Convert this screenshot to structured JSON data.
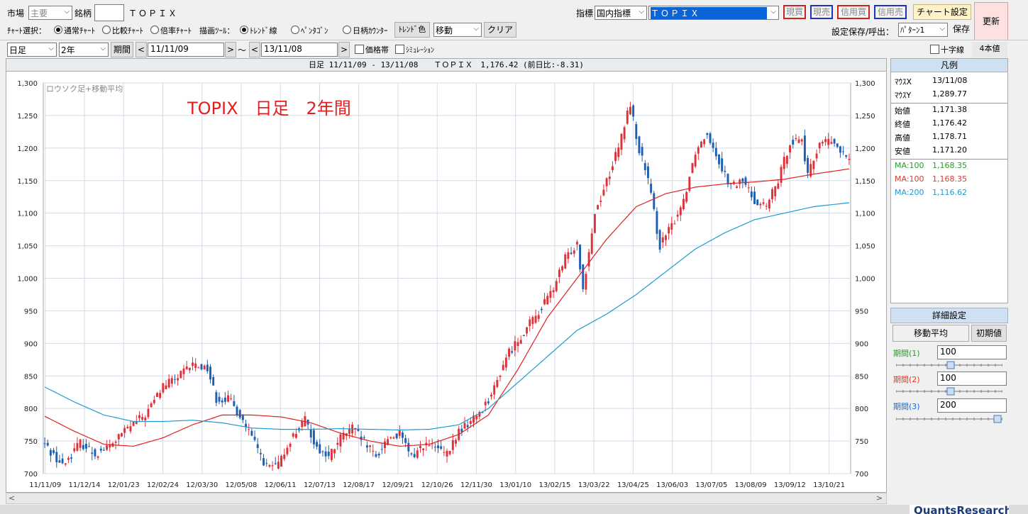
{
  "toolbar": {
    "market_label": "市場",
    "market_value": "主要",
    "symbol_label": "銘柄",
    "symbol_code": "",
    "symbol_name": "ＴＯＰＩＸ",
    "index_label": "指標",
    "index_category": "国内指標",
    "index_value": "ＴＯＰＩＸ",
    "buy_spot": "現買",
    "sell_spot": "現売",
    "buy_margin": "信用買",
    "sell_margin": "信用売",
    "chart_settings": "チャート設定",
    "refresh": "更新",
    "chart_type_label": "ﾁｬｰﾄ選択：",
    "chart_types": [
      "通常ﾁｬｰﾄ",
      "比較ﾁｬｰﾄ",
      "倍率ﾁｬｰﾄ"
    ],
    "draw_tool_label": "描画ﾂｰﾙ：",
    "draw_tools": [
      "ﾄﾚﾝﾄﾞ線",
      "ﾍﾟﾝﾀｺﾞﾝ",
      "日柄ｶｳﾝﾀｰ"
    ],
    "trend_color": "ﾄﾚﾝﾄﾞ色",
    "move_value": "移動",
    "clear": "クリア",
    "save_label": "設定保存/呼出：",
    "pattern_value": "ﾊﾟﾀｰﾝ1",
    "save": "保存",
    "interval_value": "日足",
    "span_value": "2年",
    "period_button": "期間",
    "date_from": "11/11/09",
    "tilde": "～",
    "date_to": "13/11/08",
    "price_band": "価格帯",
    "simulation": "ｼﾐｭﾚｰｼｮﾝ",
    "crosshair": "十字線",
    "four_price": "4本値"
  },
  "chart_header": "日足 11/11/09 - 13/11/08　　ＴＯＰＩＸ　1,176.42 (前日比:-8.31)",
  "chart_label": "ロウソク足+移動平均",
  "overlay_title": "TOPIX　日足　2年間",
  "legend": {
    "title": "凡例",
    "mouse_x_label": "ﾏｳｽX",
    "mouse_x": "13/11/08",
    "mouse_y_label": "ﾏｳｽY",
    "mouse_y": "1,289.77",
    "open_label": "始値",
    "open": "1,171.38",
    "close_label": "終値",
    "close": "1,176.42",
    "high_label": "高値",
    "high": "1,178.71",
    "low_label": "安値",
    "low": "1,171.20",
    "ma1_label": "MA:100",
    "ma1": "1,168.35",
    "ma2_label": "MA:100",
    "ma2": "1,168.35",
    "ma3_label": "MA:200",
    "ma3": "1,116.62"
  },
  "detail": {
    "title": "詳細設定",
    "tab": "移動平均",
    "init": "初期値",
    "p1_label": "期間(1)",
    "p1": "100",
    "p2_label": "期間(2)",
    "p2": "100",
    "p3_label": "期間(3)",
    "p3": "200"
  },
  "brand": "QuantsResearch",
  "colors": {
    "up": "#e0303a",
    "down": "#1f5fb0",
    "ma100": "#e02020",
    "ma200": "#1e9bd0",
    "ma_green": "#2a9a2a"
  },
  "chart_data": {
    "type": "candlestick",
    "y_ticks": [
      "1,300",
      "1,250",
      "1,200",
      "1,150",
      "1,100",
      "1,050",
      "1,000",
      "950",
      "900",
      "850",
      "800",
      "750",
      "700"
    ],
    "ylim": [
      700,
      1300
    ],
    "x_ticks": [
      "11/11/09",
      "11/12/14",
      "12/01/23",
      "12/02/24",
      "12/03/30",
      "12/05/08",
      "12/06/11",
      "12/07/13",
      "12/08/17",
      "12/09/21",
      "12/10/26",
      "12/11/30",
      "13/01/10",
      "13/02/15",
      "13/03/22",
      "13/04/25",
      "13/06/03",
      "13/07/05",
      "13/08/09",
      "13/09/12",
      "13/10/21"
    ],
    "price_path": [
      [
        0,
        745
      ],
      [
        6,
        712
      ],
      [
        12,
        748
      ],
      [
        17,
        730
      ],
      [
        22,
        742
      ],
      [
        28,
        770
      ],
      [
        34,
        790
      ],
      [
        40,
        835
      ],
      [
        45,
        848
      ],
      [
        50,
        868
      ],
      [
        55,
        862
      ],
      [
        58,
        815
      ],
      [
        62,
        815
      ],
      [
        66,
        790
      ],
      [
        70,
        755
      ],
      [
        75,
        710
      ],
      [
        79,
        712
      ],
      [
        83,
        752
      ],
      [
        88,
        782
      ],
      [
        92,
        740
      ],
      [
        96,
        725
      ],
      [
        100,
        755
      ],
      [
        104,
        770
      ],
      [
        108,
        748
      ],
      [
        112,
        725
      ],
      [
        116,
        755
      ],
      [
        120,
        760
      ],
      [
        124,
        725
      ],
      [
        128,
        745
      ],
      [
        132,
        740
      ],
      [
        136,
        728
      ],
      [
        140,
        765
      ],
      [
        144,
        780
      ],
      [
        148,
        800
      ],
      [
        152,
        830
      ],
      [
        156,
        880
      ],
      [
        160,
        905
      ],
      [
        164,
        930
      ],
      [
        168,
        955
      ],
      [
        172,
        985
      ],
      [
        176,
        1030
      ],
      [
        180,
        1055
      ],
      [
        182,
        985
      ],
      [
        186,
        1100
      ],
      [
        190,
        1150
      ],
      [
        194,
        1200
      ],
      [
        198,
        1270
      ],
      [
        200,
        1215
      ],
      [
        204,
        1150
      ],
      [
        208,
        1050
      ],
      [
        212,
        1080
      ],
      [
        216,
        1120
      ],
      [
        220,
        1195
      ],
      [
        224,
        1225
      ],
      [
        228,
        1180
      ],
      [
        232,
        1140
      ],
      [
        236,
        1150
      ],
      [
        240,
        1120
      ],
      [
        244,
        1110
      ],
      [
        248,
        1150
      ],
      [
        252,
        1210
      ],
      [
        256,
        1215
      ],
      [
        258,
        1155
      ],
      [
        262,
        1210
      ],
      [
        266,
        1210
      ],
      [
        270,
        1190
      ],
      [
        272,
        1178
      ]
    ],
    "ma100_path": [
      [
        0,
        788
      ],
      [
        10,
        765
      ],
      [
        20,
        745
      ],
      [
        30,
        742
      ],
      [
        40,
        755
      ],
      [
        50,
        775
      ],
      [
        60,
        790
      ],
      [
        70,
        790
      ],
      [
        80,
        787
      ],
      [
        90,
        778
      ],
      [
        100,
        762
      ],
      [
        110,
        750
      ],
      [
        120,
        742
      ],
      [
        130,
        745
      ],
      [
        140,
        760
      ],
      [
        150,
        790
      ],
      [
        160,
        860
      ],
      [
        170,
        940
      ],
      [
        180,
        1000
      ],
      [
        190,
        1060
      ],
      [
        200,
        1110
      ],
      [
        210,
        1130
      ],
      [
        220,
        1140
      ],
      [
        230,
        1145
      ],
      [
        240,
        1148
      ],
      [
        250,
        1152
      ],
      [
        260,
        1160
      ],
      [
        272,
        1168
      ]
    ],
    "ma200_path": [
      [
        0,
        833
      ],
      [
        10,
        810
      ],
      [
        20,
        790
      ],
      [
        30,
        780
      ],
      [
        40,
        780
      ],
      [
        50,
        782
      ],
      [
        60,
        778
      ],
      [
        70,
        770
      ],
      [
        80,
        768
      ],
      [
        90,
        768
      ],
      [
        100,
        769
      ],
      [
        110,
        768
      ],
      [
        120,
        767
      ],
      [
        130,
        768
      ],
      [
        140,
        775
      ],
      [
        150,
        800
      ],
      [
        160,
        840
      ],
      [
        170,
        880
      ],
      [
        180,
        920
      ],
      [
        190,
        945
      ],
      [
        200,
        975
      ],
      [
        210,
        1010
      ],
      [
        220,
        1045
      ],
      [
        230,
        1070
      ],
      [
        240,
        1090
      ],
      [
        250,
        1100
      ],
      [
        260,
        1110
      ],
      [
        272,
        1116
      ]
    ]
  }
}
